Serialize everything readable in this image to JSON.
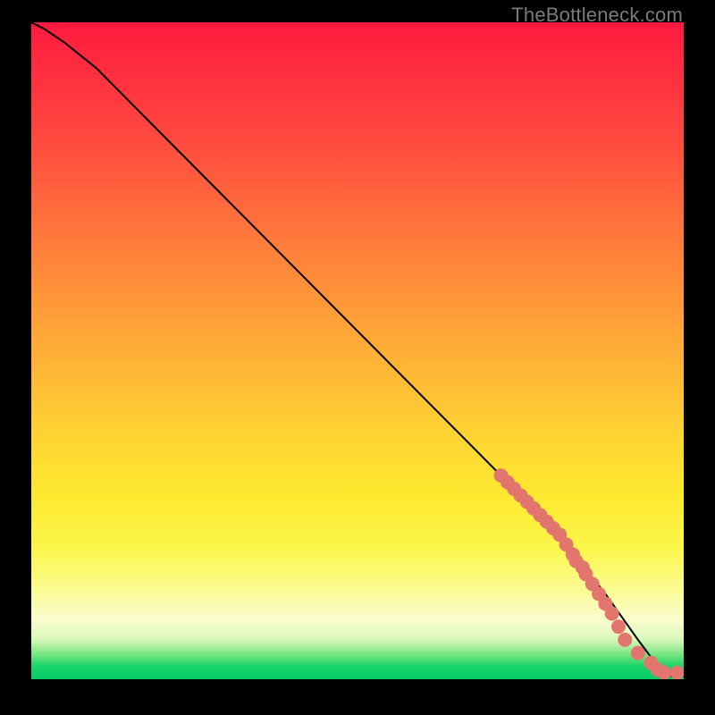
{
  "watermark": "TheBottleneck.com",
  "chart_data": {
    "type": "line",
    "title": "",
    "xlabel": "",
    "ylabel": "",
    "xlim": [
      0,
      100
    ],
    "ylim": [
      0,
      100
    ],
    "curve": {
      "name": "bottleneck-curve",
      "x": [
        0,
        2,
        5,
        10,
        20,
        30,
        40,
        50,
        60,
        70,
        80,
        88,
        93,
        96,
        98,
        100
      ],
      "y": [
        100,
        99,
        97,
        93,
        83,
        73,
        63,
        53,
        43,
        33,
        23,
        13,
        6,
        2,
        0.5,
        0.5
      ]
    },
    "points": {
      "name": "highlighted-range",
      "color": "#e2766f",
      "x": [
        72,
        73,
        74,
        75,
        76,
        77,
        78,
        79,
        80,
        81,
        82,
        83,
        83.5,
        84.5,
        85,
        86,
        87,
        88,
        89,
        90,
        91,
        93,
        95,
        96,
        97,
        99
      ],
      "y": [
        31,
        30,
        29,
        28,
        27,
        26,
        25,
        24,
        23,
        22,
        20.5,
        19,
        18,
        17,
        16,
        14.5,
        13,
        11.5,
        10,
        8,
        6,
        4,
        2.5,
        1.5,
        1,
        1
      ]
    }
  }
}
